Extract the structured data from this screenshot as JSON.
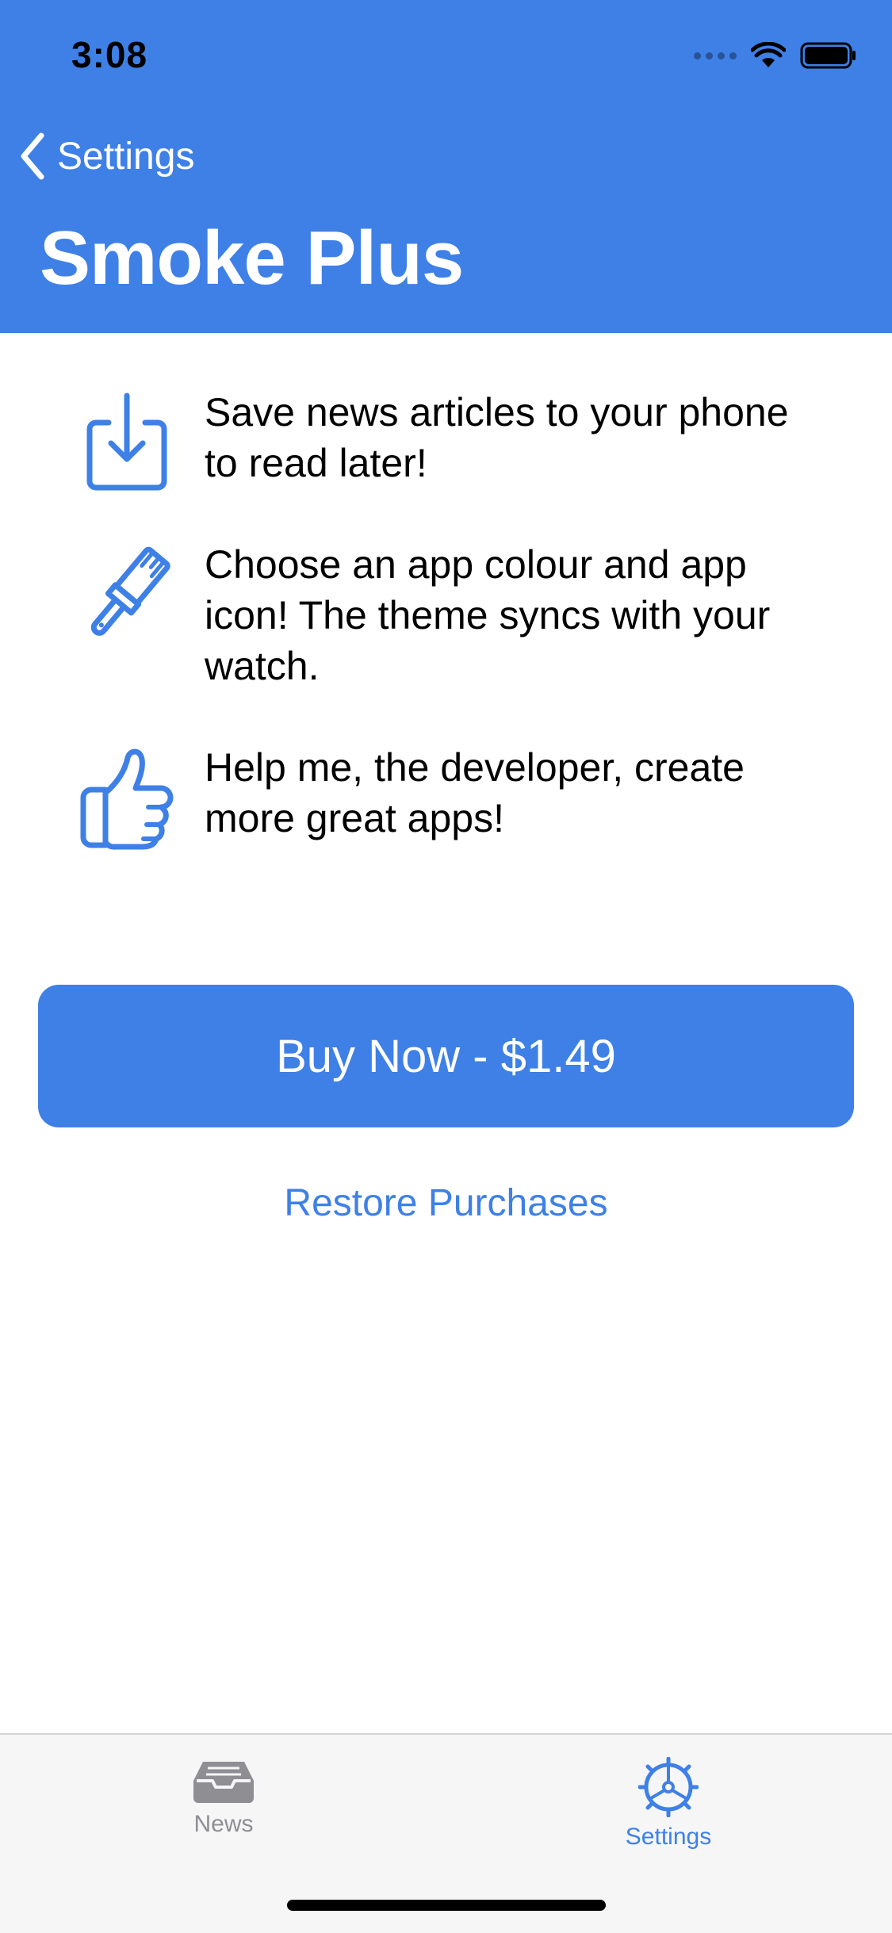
{
  "status_bar": {
    "time": "3:08",
    "icons": [
      "cellular-signal-icon",
      "wifi-icon",
      "battery-icon"
    ]
  },
  "nav": {
    "back_label": "Settings",
    "title": "Smoke Plus"
  },
  "features": [
    {
      "icon": "download-icon",
      "text": "Save news articles to your phone to read later!"
    },
    {
      "icon": "paintbrush-icon",
      "text": "Choose an app colour and app icon! The theme syncs with your watch."
    },
    {
      "icon": "thumbs-up-icon",
      "text": "Help me, the developer, create more great apps!"
    }
  ],
  "actions": {
    "buy_label": "Buy Now - $1.49",
    "restore_label": "Restore Purchases"
  },
  "tabbar": {
    "tabs": [
      {
        "label": "News",
        "icon": "inbox-tray-icon",
        "selected": false
      },
      {
        "label": "Settings",
        "icon": "gear-icon",
        "selected": true
      }
    ]
  },
  "colors": {
    "accent": "#3e80e6",
    "tab_inactive": "#8e8e93",
    "tabbar_bg": "#f6f6f7"
  }
}
